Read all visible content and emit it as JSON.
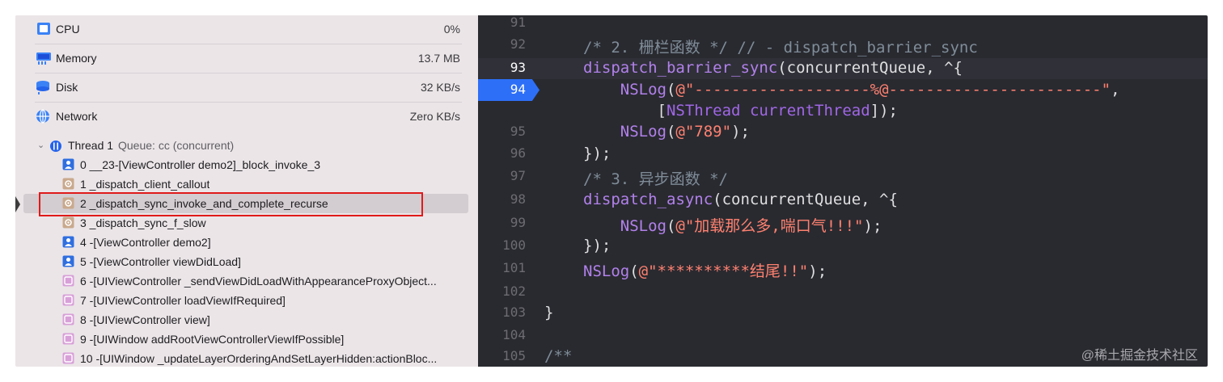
{
  "gauges": [
    {
      "name": "CPU",
      "value": "0%",
      "icon": "cpu-icon"
    },
    {
      "name": "Memory",
      "value": "13.7 MB",
      "icon": "memory-icon"
    },
    {
      "name": "Disk",
      "value": "32 KB/s",
      "icon": "disk-icon"
    },
    {
      "name": "Network",
      "value": "Zero KB/s",
      "icon": "network-icon"
    }
  ],
  "thread": {
    "name": "Thread 1",
    "queue": "Queue: cc (concurrent)"
  },
  "frames": [
    {
      "label": "0 __23-[ViewController demo2]_block_invoke_3",
      "kind": "user"
    },
    {
      "label": "1 _dispatch_client_callout",
      "kind": "system"
    },
    {
      "label": "2 _dispatch_sync_invoke_and_complete_recurse",
      "kind": "system"
    },
    {
      "label": "3 _dispatch_sync_f_slow",
      "kind": "system"
    },
    {
      "label": "4 -[ViewController demo2]",
      "kind": "user"
    },
    {
      "label": "5 -[ViewController viewDidLoad]",
      "kind": "user"
    },
    {
      "label": "6 -[UIViewController _sendViewDidLoadWithAppearanceProxyObject...",
      "kind": "uikit"
    },
    {
      "label": "7 -[UIViewController loadViewIfRequired]",
      "kind": "uikit"
    },
    {
      "label": "8 -[UIViewController view]",
      "kind": "uikit"
    },
    {
      "label": "9 -[UIWindow addRootViewControllerViewIfPossible]",
      "kind": "uikit"
    },
    {
      "label": "10 -[UIWindow _updateLayerOrderingAndSetLayerHidden:actionBloc...",
      "kind": "uikit"
    }
  ],
  "code": {
    "line_numbers": [
      "91",
      "92",
      "93",
      "94",
      "",
      "95",
      "96",
      "97",
      "98",
      "99",
      "100",
      "101",
      "102",
      "103",
      "104",
      "105"
    ],
    "line_92": {
      "comment": "/* 2. 栅栏函数 */ // - dispatch_barrier_sync"
    },
    "line_93": {
      "func": "dispatch_barrier_sync",
      "rest": "(concurrentQueue, ^{"
    },
    "line_94": {
      "indent": "    ",
      "call": "NSLog",
      "open": "(",
      "string": "@\"-------------------%@-----------------------\"",
      "tail": ","
    },
    "line_94b": {
      "indent": "        ",
      "open": "[",
      "cls": "NSThread",
      "space": " ",
      "method": "currentThread",
      "close": "]);"
    },
    "line_95": {
      "indent": "    ",
      "call": "NSLog",
      "open": "(",
      "string": "@\"789\"",
      "close": ");"
    },
    "line_96": {
      "text": "});"
    },
    "line_97": {
      "comment": "/* 3. 异步函数 */"
    },
    "line_98": {
      "func": "dispatch_async",
      "rest": "(concurrentQueue, ^{"
    },
    "line_99": {
      "indent": "    ",
      "call": "NSLog",
      "open": "(",
      "string": "@\"加载那么多,喘口气!!!\"",
      "close": ");"
    },
    "line_100": {
      "text": "});"
    },
    "line_101": {
      "call": "NSLog",
      "open": "(",
      "string": "@\"**********结尾!!\"",
      "close": ");"
    },
    "line_103": {
      "text": "}"
    },
    "line_105": {
      "comment": "/**"
    }
  },
  "watermark": "@稀土掘金技术社区",
  "colors": {
    "navigator_bg": "#ebe5e8",
    "editor_bg": "#292a30",
    "breakpoint": "#2d6ff7",
    "highlight_box": "#e01a1a",
    "string": "#ff8170",
    "function": "#b281eb",
    "comment": "#7f8c98"
  }
}
